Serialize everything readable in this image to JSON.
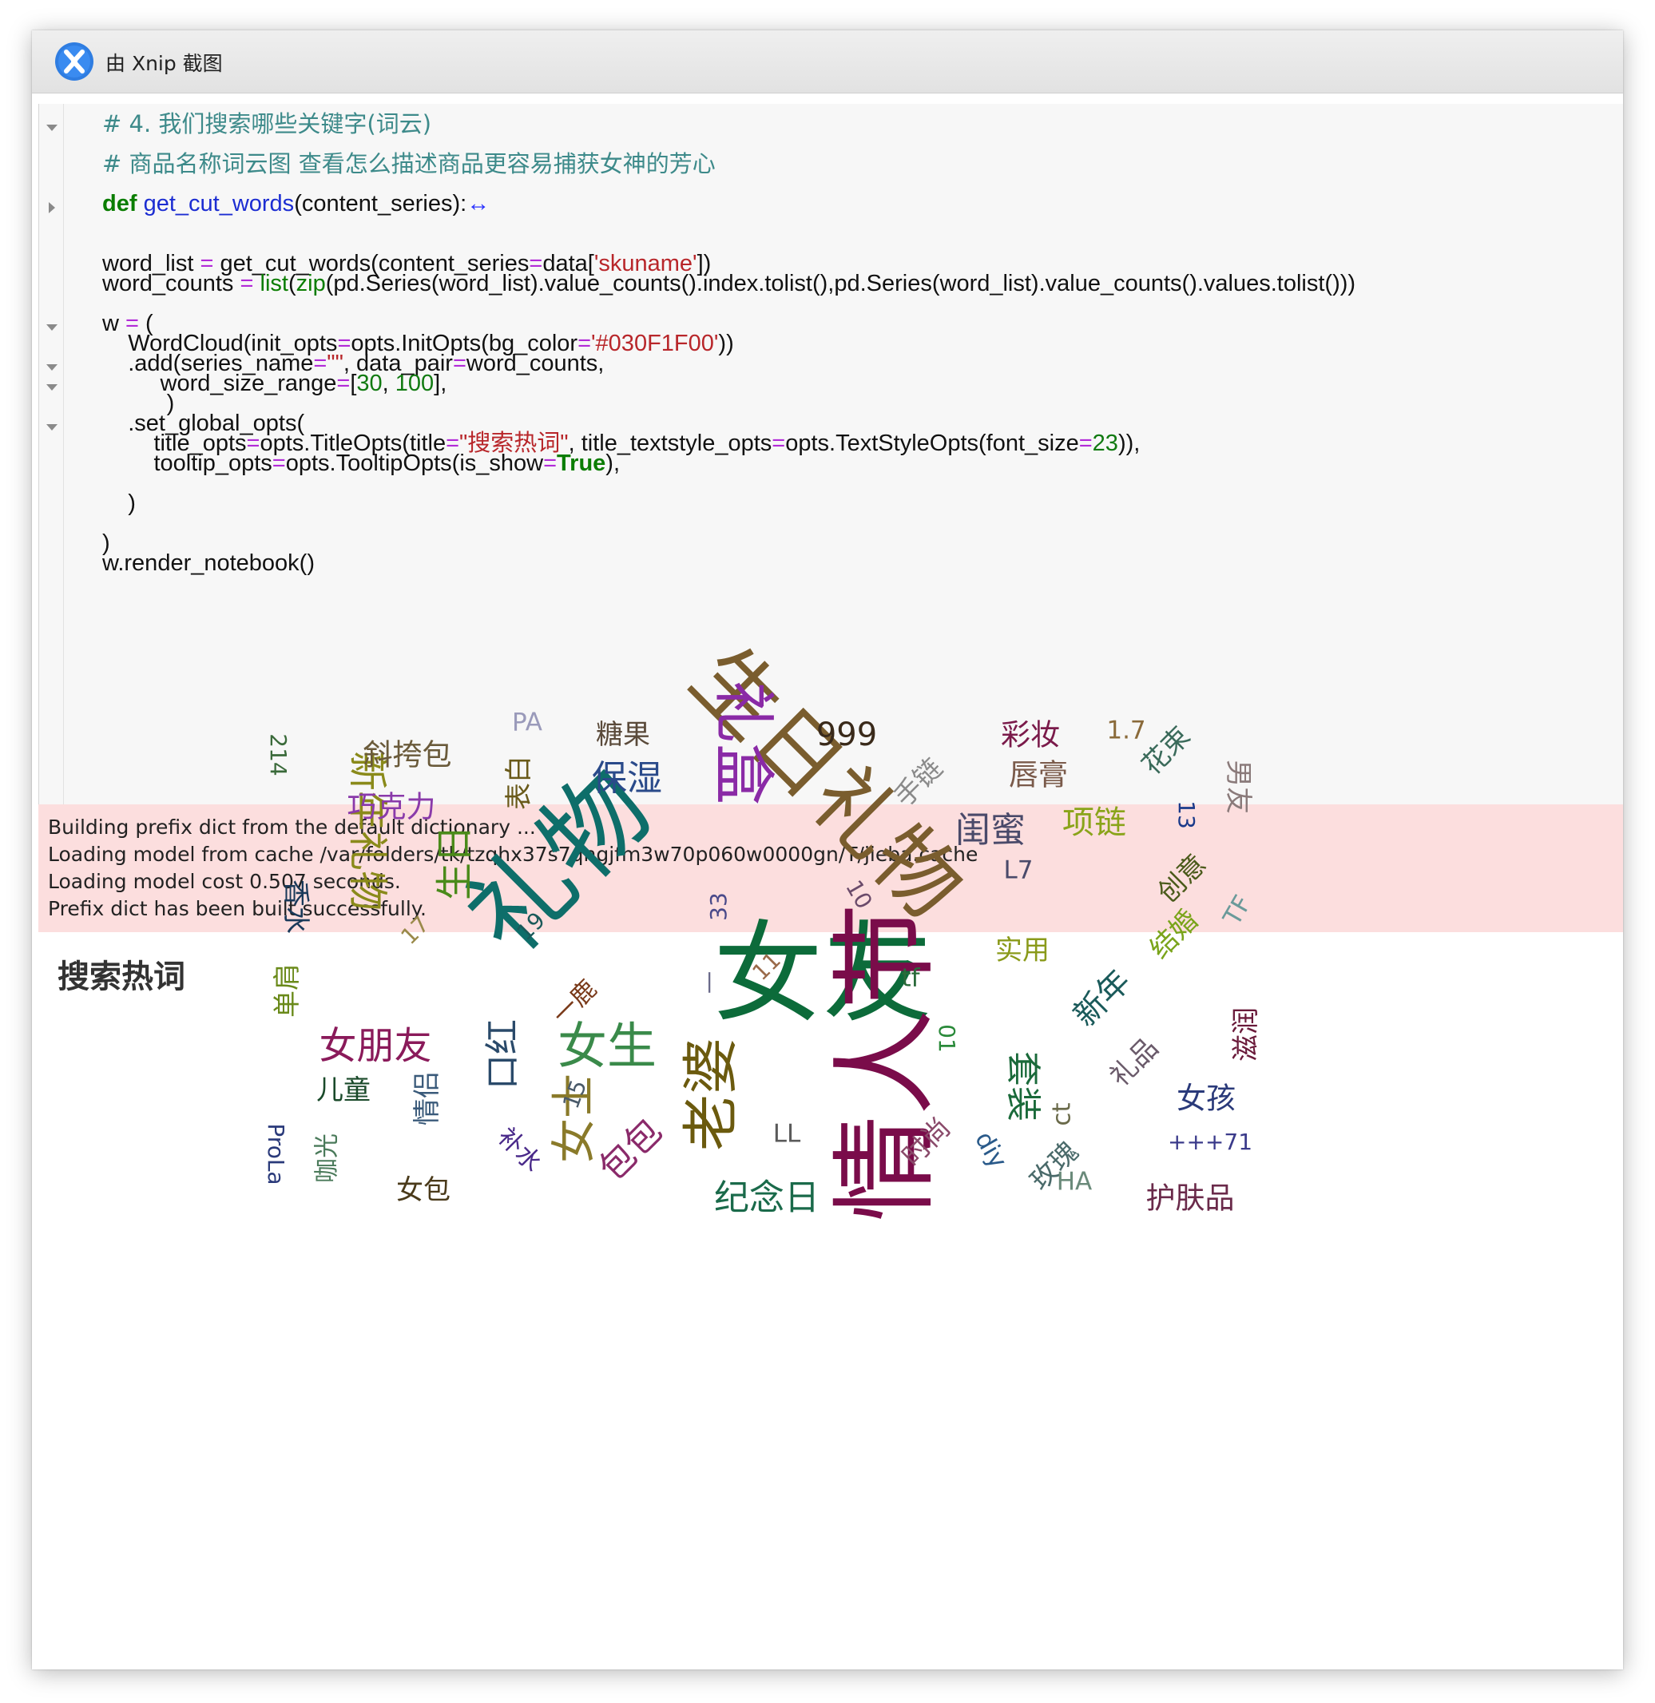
{
  "window": {
    "title": "由 Xnip 截图",
    "app_icon": "xnip-app-icon"
  },
  "code": {
    "comment1": "# 4. 我们搜索哪些关键字(词云)",
    "comment2": "# 商品名称词云图 查看怎么描述商品更容易捕获女神的芳心",
    "def_kw": "def",
    "def_name": "get_cut_words",
    "def_args": "(content_series):",
    "def_collapsed": "↔",
    "l4_a": "word_list ",
    "l4_b": "=",
    "l4_c": " get_cut_words(content_series",
    "l4_d": "=",
    "l4_e": "data[",
    "l4_f": "'skuname'",
    "l4_g": "])",
    "l5_a": "word_counts ",
    "l5_b": "=",
    "l5_c": " ",
    "l5_list": "list",
    "l5_d": "(",
    "l5_zip": "zip",
    "l5_e": "(pd.Series(word_list).value_counts().index.tolist(),pd.Series(word_list).value_counts().values.tolist()))",
    "l6_a": "w ",
    "l6_b": "=",
    "l6_c": " (",
    "l7_a": "    WordCloud(init_opts",
    "l7_b": "=",
    "l7_c": "opts.InitOpts(bg_color",
    "l7_d": "=",
    "l7_e": "'#030F1F00'",
    "l7_f": "))",
    "l8_a": "    .add(series_name",
    "l8_b": "=",
    "l8_c": "\"\"",
    "l8_d": ", data_pair",
    "l8_e": "=",
    "l8_f": "word_counts,",
    "l9_a": "         word_size_range",
    "l9_b": "=",
    "l9_c": "[",
    "l9_d": "30",
    "l9_e": ", ",
    "l9_f": "100",
    "l9_g": "],",
    "l10": "          )",
    "l11": "    .set_global_opts(",
    "l12_a": "        title_opts",
    "l12_b": "=",
    "l12_c": "opts.TitleOpts(title",
    "l12_d": "=",
    "l12_e": "\"搜索热词\"",
    "l12_f": ", title_textstyle_opts",
    "l12_g": "=",
    "l12_h": "opts.TextStyleOpts(font_size",
    "l12_i": "=",
    "l12_j": "23",
    "l12_k": ")),",
    "l13_a": "        tooltip_opts",
    "l13_b": "=",
    "l13_c": "opts.TooltipOpts(is_show",
    "l13_d": "=",
    "l13_e": "True",
    "l13_f": "),",
    "l14": "    )",
    "l15": ")",
    "l16": "w.render_notebook()"
  },
  "stderr": [
    "Building prefix dict from the default dictionary ...",
    "Loading model from cache /var/folders/tk/tzqhx37s7qngjfm3w70p060w0000gn/T/jieba.cache",
    "Loading model cost 0.507 seconds.",
    "Prefix dict has been built successfully."
  ],
  "chart_data": {
    "type": "wordcloud",
    "title": "搜索热词",
    "words": [
      {
        "word": "女友",
        "size": 100,
        "color": "#0c6b3a"
      },
      {
        "word": "情人节",
        "size": 98,
        "color": "#7a0c4a"
      },
      {
        "word": "礼物",
        "size": 95,
        "color": "#0e6e6a"
      },
      {
        "word": "生日礼物",
        "size": 80,
        "color": "#7a5d2e"
      },
      {
        "word": "礼盒",
        "size": 62,
        "color": "#8a2aa6"
      },
      {
        "word": "老婆",
        "size": 58,
        "color": "#6b5a0e"
      },
      {
        "word": "女生",
        "size": 52,
        "color": "#3a8a4a"
      },
      {
        "word": "女士",
        "size": 48,
        "color": "#8a7a2a"
      },
      {
        "word": "新年礼物",
        "size": 44,
        "color": "#8a8a1a"
      },
      {
        "word": "女朋友",
        "size": 42,
        "color": "#8a1a5a"
      },
      {
        "word": "生日",
        "size": 42,
        "color": "#4a8a1a"
      },
      {
        "word": "口红",
        "size": 40,
        "color": "#2a4a6a"
      },
      {
        "word": "包包",
        "size": 40,
        "color": "#8a2a6a"
      },
      {
        "word": "闺蜜",
        "size": 40,
        "color": "#4a4a6a"
      },
      {
        "word": "保湿",
        "size": 40,
        "color": "#2a4a8a"
      },
      {
        "word": "纪念日",
        "size": 40,
        "color": "#1a6a4a"
      },
      {
        "word": "套装",
        "size": 40,
        "color": "#1a6a3a"
      },
      {
        "word": "999",
        "size": 38,
        "color": "#3a2a1a"
      },
      {
        "word": "新年",
        "size": 38,
        "color": "#1a5a5a"
      },
      {
        "word": "项链",
        "size": 38,
        "color": "#8aa41a"
      },
      {
        "word": "巧克力",
        "size": 36,
        "color": "#8a3aaa"
      },
      {
        "word": "斜挎包",
        "size": 36,
        "color": "#6a5a3a"
      },
      {
        "word": "女孩",
        "size": 36,
        "color": "#2a3a7a"
      },
      {
        "word": "护肤品",
        "size": 36,
        "color": "#6a2a4a"
      },
      {
        "word": "唇膏",
        "size": 36,
        "color": "#7a5a4a"
      },
      {
        "word": "彩妆",
        "size": 36,
        "color": "#7a1a4a"
      },
      {
        "word": "糖果",
        "size": 34,
        "color": "#5a4a3a"
      },
      {
        "word": "结婚",
        "size": 34,
        "color": "#7aa41a"
      },
      {
        "word": "滋润",
        "size": 34,
        "color": "#6a1a3a"
      },
      {
        "word": "花束",
        "size": 34,
        "color": "#3a6a5a"
      },
      {
        "word": "儿童",
        "size": 34,
        "color": "#1a4a2a"
      },
      {
        "word": "情侣",
        "size": 34,
        "color": "#3a5a7a"
      },
      {
        "word": "女包",
        "size": 34,
        "color": "#4a3a1a"
      },
      {
        "word": "香水",
        "size": 34,
        "color": "#1a3a5a"
      },
      {
        "word": "单肩",
        "size": 34,
        "color": "#6a8a1a"
      },
      {
        "word": "表白",
        "size": 34,
        "color": "#6a5a1a"
      },
      {
        "word": "时尚",
        "size": 34,
        "color": "#8a4a6a"
      },
      {
        "word": "玫瑰",
        "size": 34,
        "color": "#4a6a6a"
      },
      {
        "word": "礼品",
        "size": 34,
        "color": "#6a5a6a"
      },
      {
        "word": "实用",
        "size": 34,
        "color": "#8a9a1a"
      },
      {
        "word": "创意",
        "size": 34,
        "color": "#4a5a1a"
      },
      {
        "word": "手链",
        "size": 34,
        "color": "#8a8a8a"
      },
      {
        "word": "男友",
        "size": 34,
        "color": "#8a7a7a"
      },
      {
        "word": "一鹿",
        "size": 32,
        "color": "#7a3a1a"
      },
      {
        "word": "补水",
        "size": 32,
        "color": "#4a2a8a"
      },
      {
        "word": "咖光",
        "size": 32,
        "color": "#4a7a5a"
      },
      {
        "word": "PA",
        "size": 32,
        "color": "#9a9aba"
      },
      {
        "word": "1.7",
        "size": 32,
        "color": "#8a6a3a"
      },
      {
        "word": "L7",
        "size": 32,
        "color": "#4a4a6a"
      },
      {
        "word": "LL",
        "size": 32,
        "color": "#5a5a5a"
      },
      {
        "word": "HA",
        "size": 32,
        "color": "#6a8a7a"
      },
      {
        "word": "ct",
        "size": 32,
        "color": "#6a6a4a"
      },
      {
        "word": "tf",
        "size": 32,
        "color": "#2a6a3a"
      },
      {
        "word": "TF",
        "size": 32,
        "color": "#6a9a9a"
      },
      {
        "word": "diy",
        "size": 32,
        "color": "#2a5a8a"
      },
      {
        "word": "ProLa",
        "size": 30,
        "color": "#2a3a7a"
      },
      {
        "word": "+++71",
        "size": 30,
        "color": "#3a3a8a"
      },
      {
        "word": "214",
        "size": 30,
        "color": "#3a6a3a"
      },
      {
        "word": "33",
        "size": 30,
        "color": "#4a4a8a"
      },
      {
        "word": "13",
        "size": 30,
        "color": "#1a3a8a"
      },
      {
        "word": "15",
        "size": 30,
        "color": "#4a5a6a"
      },
      {
        "word": "17",
        "size": 30,
        "color": "#9a8a4a"
      },
      {
        "word": "19",
        "size": 30,
        "color": "#1a5a5a"
      },
      {
        "word": "10",
        "size": 30,
        "color": "#6a4a6a"
      },
      {
        "word": "11",
        "size": 30,
        "color": "#9a6a4a"
      },
      {
        "word": "01",
        "size": 30,
        "color": "#2a8a3a"
      },
      {
        "word": "一",
        "size": 30,
        "color": "#6a6a8a"
      }
    ]
  }
}
